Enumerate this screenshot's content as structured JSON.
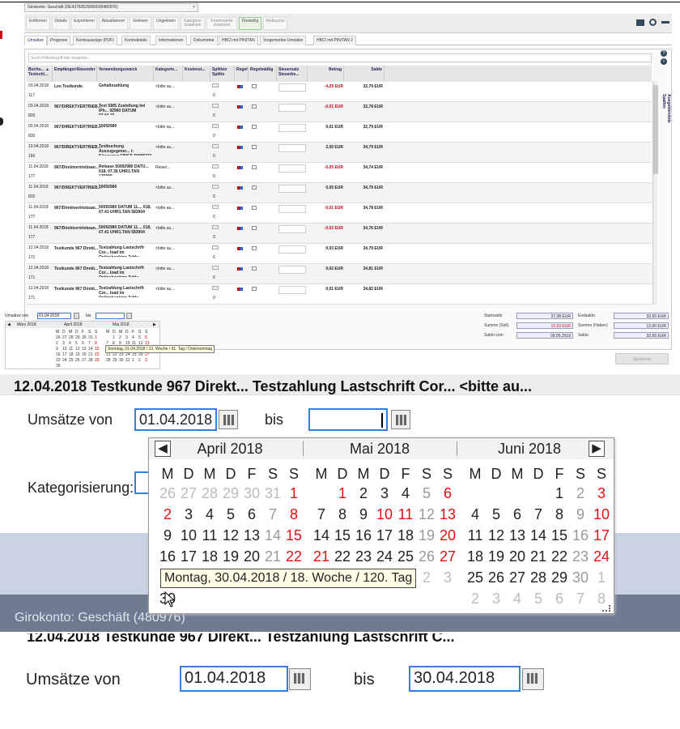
{
  "window": {
    "tab_title": "Girokonto: Geschäft (DE43750529900000480976)",
    "tab_close": "×"
  },
  "toolbar": {
    "buttons": [
      "Entfernen",
      "Details",
      "Exportieren",
      "Aktualisieren",
      "Gelesen",
      "Ungelesen",
      "Kategorie zuweisen",
      "Kostenstelle zuweisen",
      "Dreizeilig",
      "Websuche"
    ],
    "right_icons": [
      "printer-icon",
      "settings-icon",
      "back-arrow-icon"
    ]
  },
  "tabs": [
    "Umsätze",
    "Prognose",
    "Kontoauszüge (PDF)",
    "Kontodetails",
    "Informationen",
    "Dokumente",
    "HBCI mit PIN/TAN",
    "Vorgemerkte Umsätze",
    "HBCI mit PIN/TAN 2"
  ],
  "search": {
    "placeholder": "Such-/Filterbegriff hier eingeben"
  },
  "side_panel": {
    "label": "Ausgeblendete Spalten",
    "icons": [
      "help-icon",
      "info-icon"
    ]
  },
  "grid": {
    "columns": [
      "Buchu... ▲ Textschl...",
      "Empfänger/Absender",
      "Verwendungszweck",
      "Kategorie...",
      "Kostenst...",
      "Splitten Splitts",
      "Regel",
      "Regelmäßig",
      "Steuersatz Steuerbe...",
      "Betrag",
      "Saldo"
    ],
    "rows": [
      {
        "date": "03.04.2018",
        "code": "117",
        "sender": "Leo Testkunde",
        "purpose": "Gehaltszahlung",
        "cat": "<bitte au...",
        "splits": "0",
        "amount": "-4,29 EUR",
        "neg": true,
        "saldo": "32,79 EUR"
      },
      {
        "date": "03.04.2018",
        "code": "820",
        "sender": "967/DIREKTVERTRIEB...",
        "purpose": "Test SMS Zustellung bei iPh... 92980 DATUM 03.04.20...",
        "cat": "<bitte au...",
        "splits": "0",
        "amount": "-0,01 EUR",
        "neg": true,
        "saldo": "32,78 EUR"
      },
      {
        "date": "03.04.2018",
        "code": "820",
        "sender": "967/DIREKTVERTRIEB...",
        "purpose": "50092980",
        "cat": "<bitte au...",
        "splits": "0",
        "amount": "0,01 EUR",
        "neg": false,
        "saldo": "32,79 EUR"
      },
      {
        "date": "10.04.2018",
        "code": "166",
        "sender": "967/DIREKTVERTRIEB...",
        "purpose": "Testbuchung Auszugsgener... t: Klausuzug EBICS 50096771",
        "cat": "<bitte au...",
        "splits": "0",
        "amount": "2,00 EUR",
        "neg": false,
        "saldo": "34,79 EUR"
      },
      {
        "date": "11.04.2018",
        "code": "177",
        "sender": "967/Direktvertriebsan...",
        "purpose": "Release 50092980 DATU... 018, 07.35 UHR1.TAN 176090",
        "cat": "Reise/...",
        "splits": "0",
        "amount": "-0,05 EUR",
        "neg": true,
        "saldo": "34,74 EUR"
      },
      {
        "date": "11.04.2018",
        "code": "820",
        "sender": "967/DIREKTVERTRIEB...",
        "purpose": "50092980",
        "cat": "<bitte au...",
        "splits": "0",
        "amount": "0,05 EUR",
        "neg": false,
        "saldo": "34,79 EUR"
      },
      {
        "date": "11.04.2018",
        "code": "177",
        "sender": "967/Direktvertriebsan...",
        "purpose": "50092980 DATUM 11.... 018, 07.41 UHR1.TAN 583904",
        "cat": "<bitte au...",
        "splits": "0",
        "amount": "-0,01 EUR",
        "neg": true,
        "saldo": "34,78 EUR"
      },
      {
        "date": "11.04.2018",
        "code": "177",
        "sender": "967/Direktvertriebsan...",
        "purpose": "50092980 DATUM 11.... 018, 07.41 UHR1.TAN 583904",
        "cat": "<bitte au...",
        "splits": "0",
        "amount": "-0,02 EUR",
        "neg": true,
        "saldo": "34,76 EUR"
      },
      {
        "date": "12.04.2018",
        "code": "171",
        "sender": "Testkunde 967 Direkt...",
        "purpose": "Testzahlung Lastschrift Cor... load im Onlinebanking Zahlu...",
        "cat": "<bitte au...",
        "splits": "0",
        "amount": "0,03 EUR",
        "neg": false,
        "saldo": "34,79 EUR"
      },
      {
        "date": "12.04.2018",
        "code": "171",
        "sender": "Testkunde 967 Direkt...",
        "purpose": "Testzahlung Lastschrift Cor... load im Onlinebanking Zahlu...",
        "cat": "<bitte au...",
        "splits": "0",
        "amount": "0,02 EUR",
        "neg": false,
        "saldo": "34,81 EUR"
      },
      {
        "date": "12.04.2018",
        "code": "171",
        "sender": "Testkunde 967 Direkt...",
        "purpose": "Testzahlung Lastschrift Cor... load im Onlinebanking Zahlu...",
        "cat": "<bitte au...",
        "splits": "0",
        "amount": "0,01 EUR",
        "neg": false,
        "saldo": "34,82 EUR"
      },
      {
        "date": "12.04.2018",
        "code": "",
        "sender": "Testkunde 967 Direkt...",
        "purpose": "Testzahlung Lastschrift Cor...",
        "cat": "<bitte au...",
        "splits": "",
        "amount": "0,01 EUR",
        "neg": false,
        "saldo": "34,83 EUR"
      }
    ]
  },
  "summary": {
    "startsaldo_label": "Startsaldo",
    "startsaldo": "37,08 EUR",
    "endsaldo_label": "Endsaldo",
    "endsaldo": "32,55 EUR",
    "soll_label": "Summe (Soll)",
    "soll": "16,53 EUR",
    "haben_label": "Summe (Haben)",
    "haben": "12,00 EUR",
    "saldovom_label": "Saldo vom",
    "saldovom": "09.05.2018",
    "saldo_label": "Saldo",
    "saldo": "32,55 EUR",
    "save_label": "Speichern"
  },
  "mini_filter": {
    "from_label": "Umsätze von",
    "from_value": "01.04.2018",
    "to_label": "bis",
    "months": [
      "März 2018",
      "April 2018",
      "Mai 2018"
    ],
    "tooltip": "Sonntag, 01.04.2018 / 13. Woche / 91. Tag / Ostersonntag"
  },
  "zoom": {
    "ghost_row": "12.04.2018   Testkunde 967 Direkt...   Testzahlung Lastschrift Cor...   <bitte au...",
    "from_label": "Umsätze von",
    "from_value": "01.04.2018",
    "to_label": "bis",
    "to_value": "",
    "kategorisierung_label": "Kategorisierung:",
    "girokonto": "Girokonto: Geschäft (480976)",
    "weekdays": [
      "M",
      "D",
      "M",
      "D",
      "F",
      "S",
      "S"
    ],
    "months": [
      {
        "title": "April 2018",
        "days": [
          [
            "26",
            "27",
            "28",
            "29",
            "30",
            "31",
            "1"
          ],
          [
            "2",
            "3",
            "4",
            "5",
            "6",
            "7",
            "8"
          ],
          [
            "9",
            "10",
            "11",
            "12",
            "13",
            "14",
            "15"
          ],
          [
            "16",
            "17",
            "18",
            "19",
            "20",
            "21",
            "22"
          ],
          [
            "23",
            "24",
            "25",
            "26",
            "27",
            "28",
            "29"
          ],
          [
            "30",
            "",
            "",
            "",
            "",
            "",
            ""
          ]
        ]
      },
      {
        "title": "Mai 2018",
        "days": [
          [
            "",
            "1",
            "2",
            "3",
            "4",
            "5",
            "6"
          ],
          [
            "7",
            "8",
            "9",
            "10",
            "11",
            "12",
            "13"
          ],
          [
            "14",
            "15",
            "16",
            "17",
            "18",
            "19",
            "20"
          ],
          [
            "21",
            "22",
            "23",
            "24",
            "25",
            "26",
            "27"
          ],
          [
            "28",
            "29",
            "30",
            "31",
            "1",
            "2",
            "3"
          ],
          [
            "",
            "",
            "",
            "",
            "",
            "",
            ""
          ]
        ]
      },
      {
        "title": "Juni 2018",
        "days": [
          [
            "",
            "",
            "",
            "",
            "1",
            "2",
            "3"
          ],
          [
            "4",
            "5",
            "6",
            "7",
            "8",
            "9",
            "10"
          ],
          [
            "11",
            "12",
            "13",
            "14",
            "15",
            "16",
            "17"
          ],
          [
            "18",
            "19",
            "20",
            "21",
            "22",
            "23",
            "24"
          ],
          [
            "25",
            "26",
            "27",
            "28",
            "29",
            "30",
            "1"
          ],
          [
            "2",
            "3",
            "4",
            "5",
            "6",
            "7",
            "8"
          ]
        ]
      }
    ],
    "tooltip": "Montag, 30.04.2018 / 18. Woche / 120. Tag",
    "prev": "◀",
    "next": "▶"
  },
  "final": {
    "ghost_row": "12.04.2018   Testkunde 967 Direkt...   Testzahlung Lastschrift C...",
    "from_label": "Umsätze von",
    "from_value": "01.04.2018",
    "to_label": "bis",
    "to_value": "30.04.2018"
  }
}
